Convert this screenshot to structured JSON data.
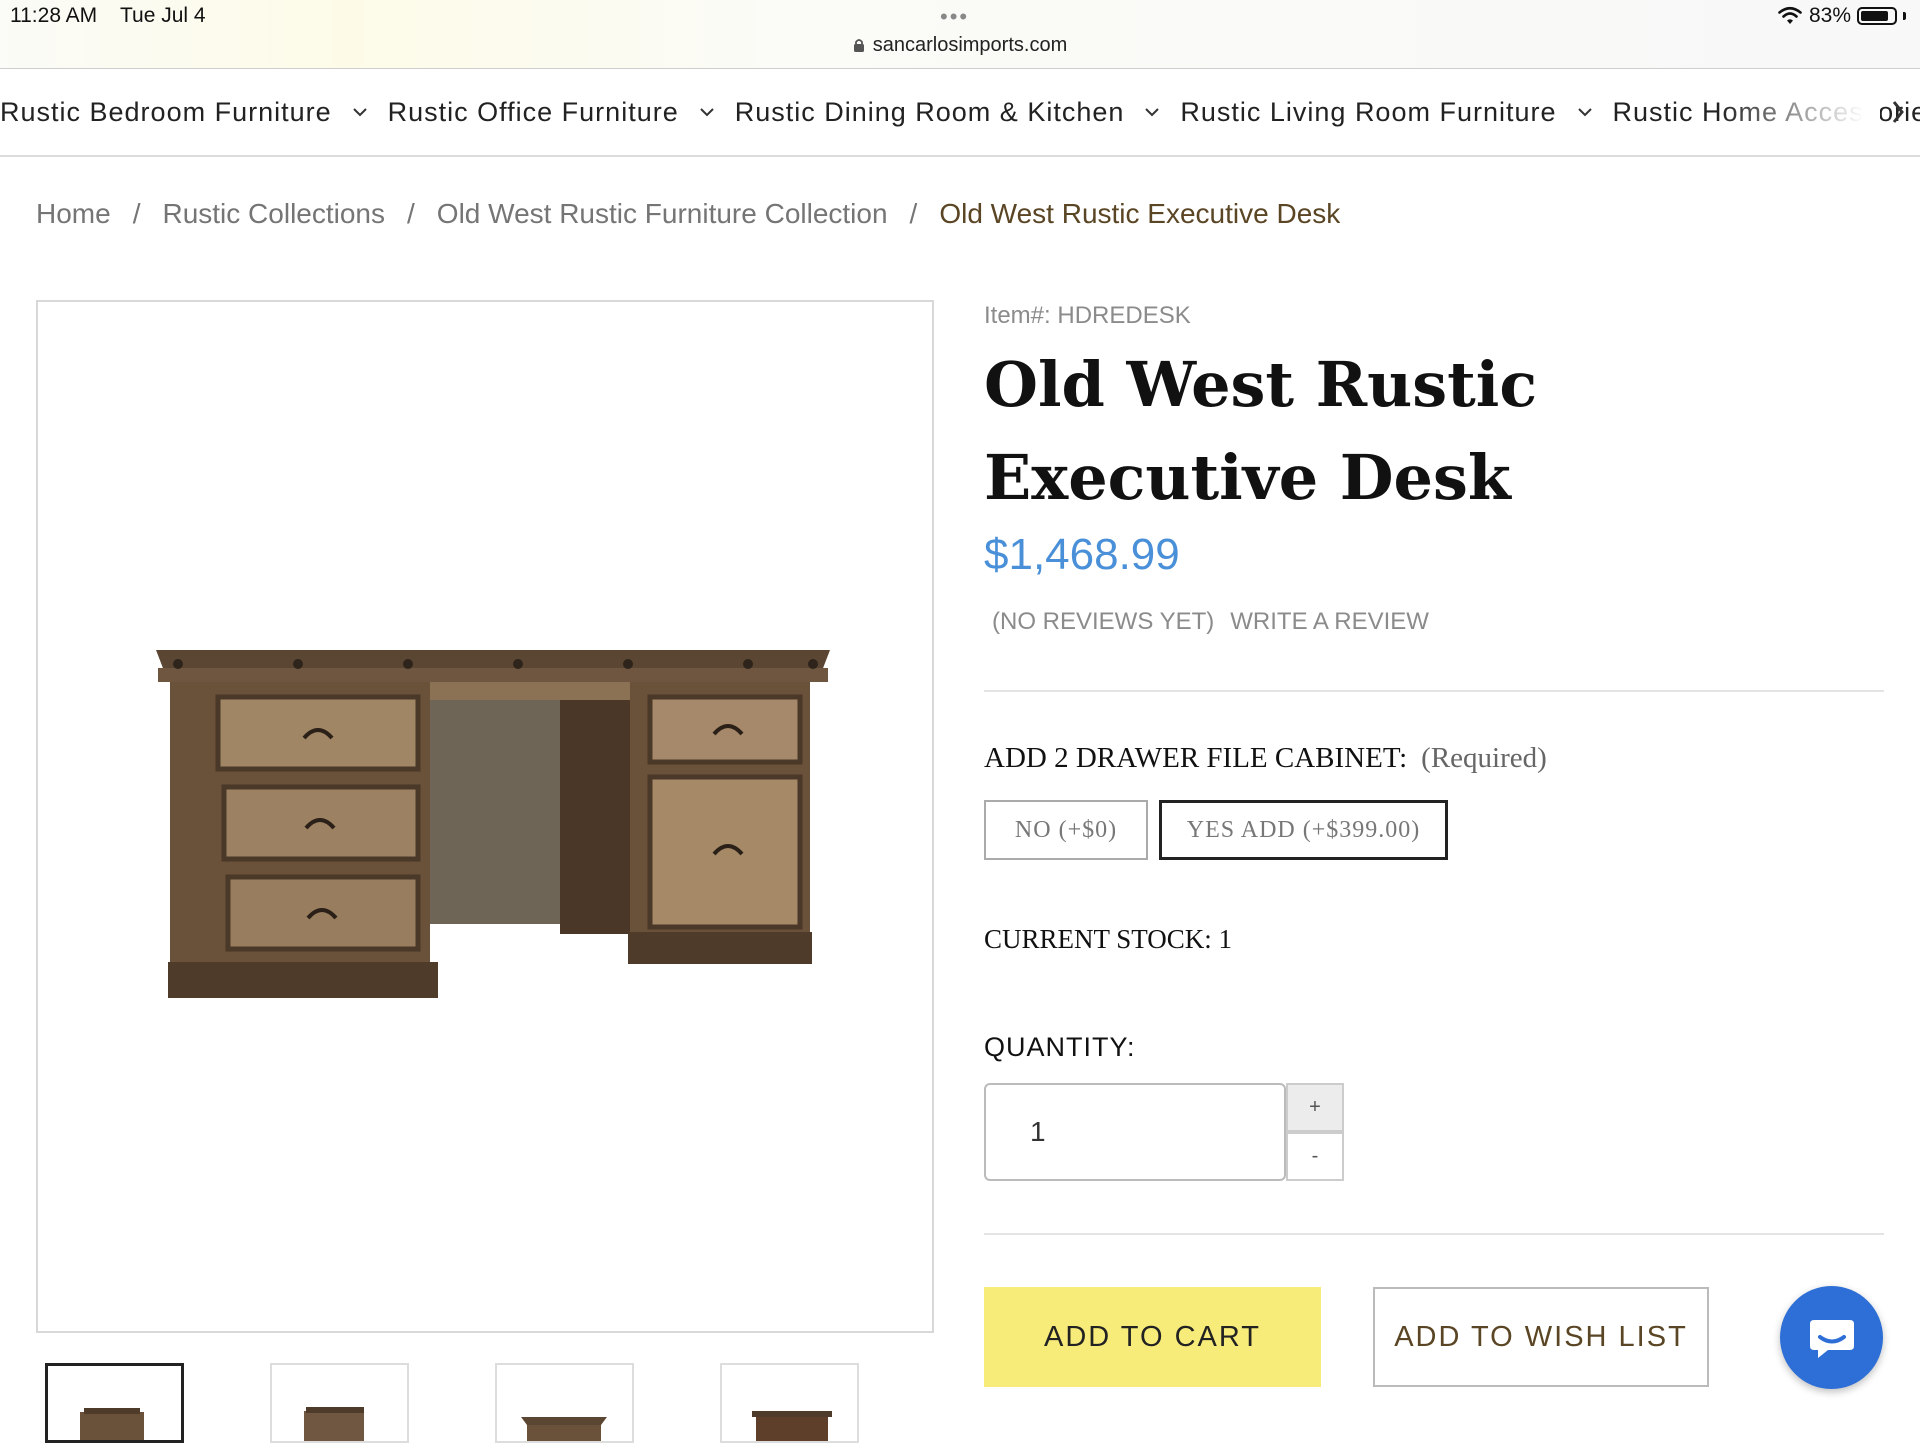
{
  "status_bar": {
    "time": "11:28 AM",
    "date": "Tue Jul 4",
    "battery": "83%",
    "battery_level": 0.83
  },
  "browser": {
    "url": "sancarlosimports.com"
  },
  "nav": {
    "items": [
      "Rustic Bedroom Furniture",
      "Rustic Office Furniture",
      "Rustic Dining Room & Kitchen",
      "Rustic Living Room Furniture",
      "Rustic Home Accessories & D"
    ]
  },
  "breadcrumb": [
    "Home",
    "Rustic Collections",
    "Old West Rustic Furniture Collection",
    "Old West Rustic Executive Desk"
  ],
  "product": {
    "item_number": "Item#: HDREDESK",
    "title": "Old West Rustic Executive Desk",
    "price": "$1,468.99",
    "reviews_text": "(NO REVIEWS YET)",
    "write_review": "WRITE A REVIEW",
    "option_label": "ADD 2 DRAWER FILE CABINET:",
    "option_required": "(Required)",
    "options": [
      "NO (+$0)",
      "YES ADD (+$399.00)"
    ],
    "selected_option": "YES ADD (+$399.00)",
    "stock": "CURRENT STOCK: 1",
    "quantity_label": "QUANTITY:",
    "quantity": "1",
    "qty_plus": "+",
    "qty_minus": "-",
    "add_to_cart": "ADD TO CART",
    "add_to_wishlist": "ADD TO WISH LIST"
  },
  "colors": {
    "accent_yellow": "#f7eb7a",
    "price_blue": "#4a90d9",
    "chat_blue": "#2d6fd6",
    "breadcrumb_current": "#5a4524"
  },
  "icons": [
    "lock-icon",
    "wifi-icon",
    "battery-icon",
    "chevron-down-icon",
    "chevron-right-icon",
    "chat-icon"
  ]
}
